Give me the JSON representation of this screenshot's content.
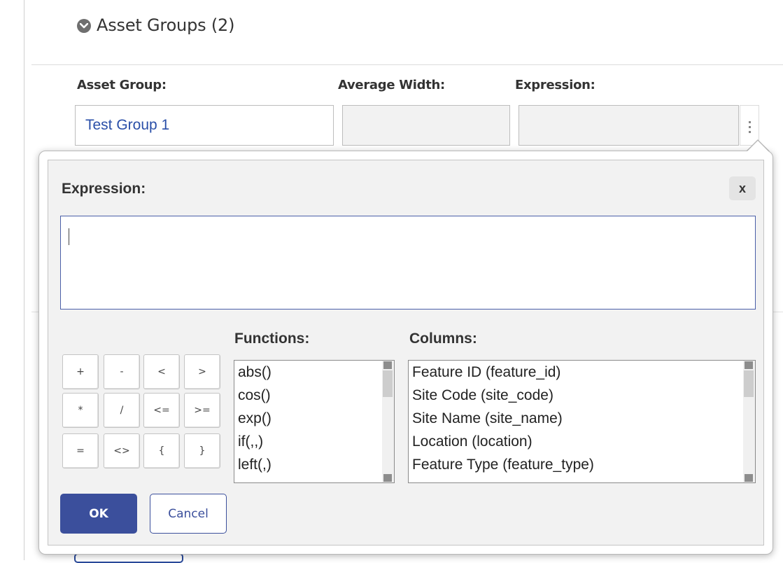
{
  "section": {
    "title": "Asset Groups (2)",
    "toggle_icon": "chevron-down-circle-icon"
  },
  "fields": {
    "asset_group_label": "Asset Group:",
    "asset_group_value": "Test Group 1",
    "average_width_label": "Average Width:",
    "average_width_value": "",
    "expression_label": "Expression:",
    "expression_value": "",
    "more_icon": "vertical-ellipsis-icon"
  },
  "popup": {
    "title": "Expression:",
    "close_label": "x",
    "expression_text": "",
    "operators_row1": [
      "+",
      "-",
      "<",
      ">"
    ],
    "operators_row2": [
      "*",
      "/",
      "<=",
      ">="
    ],
    "operators_row3": [
      "=",
      "<>",
      "{",
      "}"
    ],
    "functions_label": "Functions:",
    "functions": [
      "abs()",
      "cos()",
      "exp()",
      "if(,,)",
      "left(,)"
    ],
    "columns_label": "Columns:",
    "columns": [
      "Feature ID (feature_id)",
      "Site Code (site_code)",
      "Site Name (site_name)",
      "Location (location)",
      "Feature Type (feature_type)"
    ],
    "ok_label": "OK",
    "cancel_label": "Cancel"
  }
}
